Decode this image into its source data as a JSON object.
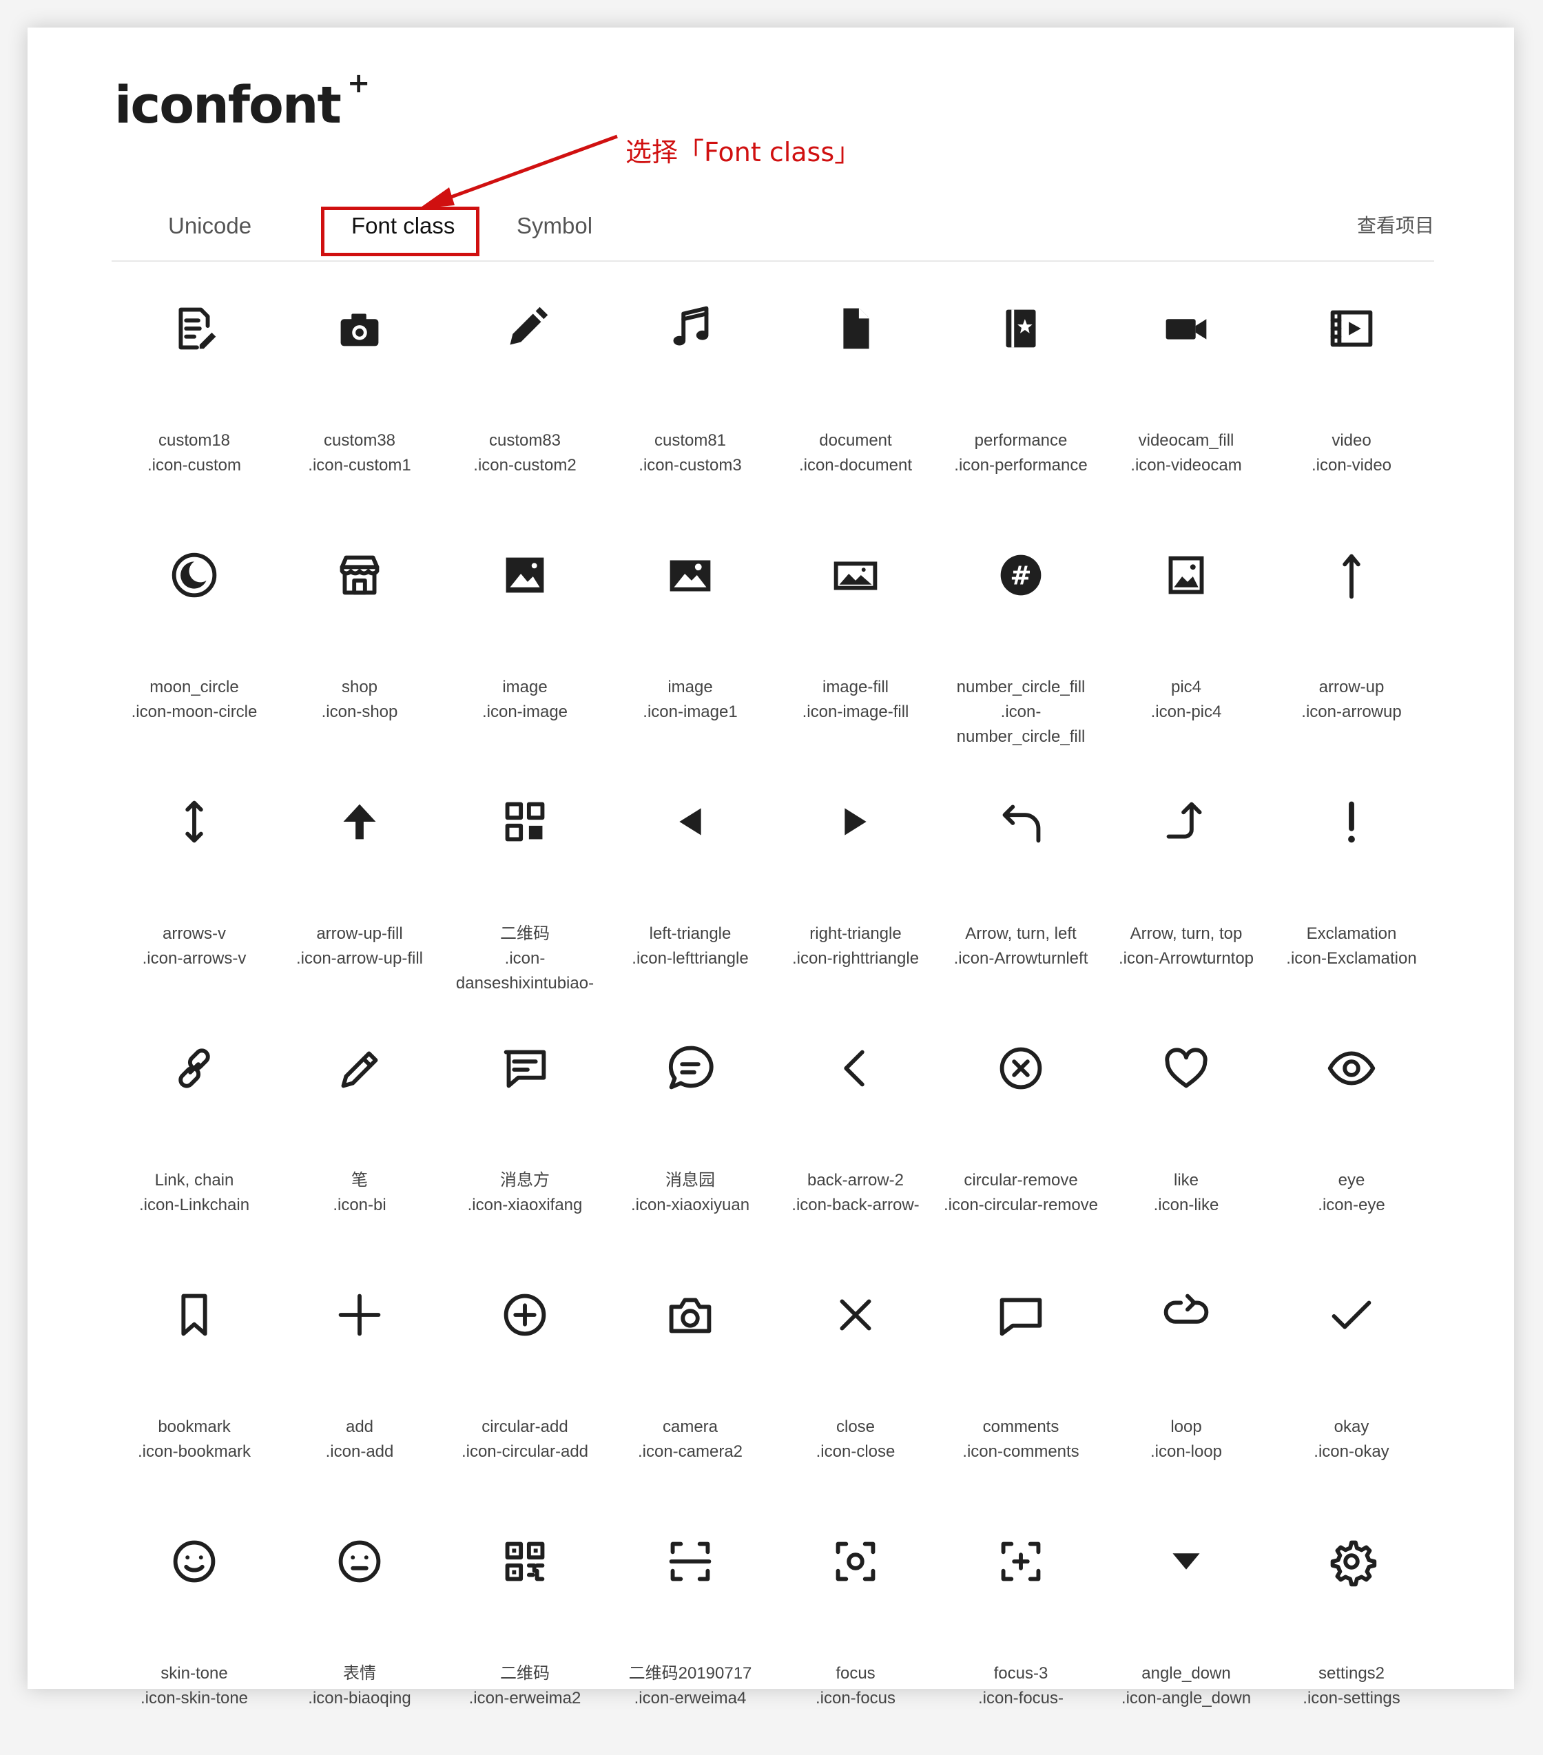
{
  "header": {
    "logo_text": "iconfont",
    "logo_sup": "+",
    "annotation": "选择「Font class」",
    "accent_color": "#d01010"
  },
  "tabs": [
    {
      "label": "Unicode",
      "active": false
    },
    {
      "label": "Font class",
      "active": true
    },
    {
      "label": "Symbol",
      "active": false
    }
  ],
  "view_project": "查看项目",
  "icons": [
    {
      "name": "custom18",
      "class": ".icon-custom",
      "icon": "note-edit-icon"
    },
    {
      "name": "custom38",
      "class": ".icon-custom1",
      "icon": "camera-fill-icon"
    },
    {
      "name": "custom83",
      "class": ".icon-custom2",
      "icon": "pencil-fill-icon"
    },
    {
      "name": "custom81",
      "class": ".icon-custom3",
      "icon": "music-note-icon"
    },
    {
      "name": "document",
      "class": ".icon-document",
      "icon": "document-icon"
    },
    {
      "name": "performance",
      "class": ".icon-performance",
      "icon": "performance-icon"
    },
    {
      "name": "videocam_fill",
      "class": ".icon-videocam",
      "icon": "videocam-icon"
    },
    {
      "name": "video",
      "class": ".icon-video",
      "icon": "video-icon"
    },
    {
      "name": "moon_circle",
      "class": ".icon-moon-circle",
      "icon": "moon-circle-icon"
    },
    {
      "name": "shop",
      "class": ".icon-shop",
      "icon": "shop-icon"
    },
    {
      "name": "image",
      "class": ".icon-image",
      "icon": "image-icon"
    },
    {
      "name": "image",
      "class": ".icon-image1",
      "icon": "image-alt-icon"
    },
    {
      "name": "image-fill",
      "class": ".icon-image-fill",
      "icon": "image-fill-icon"
    },
    {
      "name": "number_circle_fill",
      "class": ".icon-number_circle_fill",
      "icon": "number-circle-icon"
    },
    {
      "name": "pic4",
      "class": ".icon-pic4",
      "icon": "pic-icon"
    },
    {
      "name": "arrow-up",
      "class": ".icon-arrowup",
      "icon": "arrow-up-icon"
    },
    {
      "name": "arrows-v",
      "class": ".icon-arrows-v",
      "icon": "arrows-vertical-icon"
    },
    {
      "name": "arrow-up-fill",
      "class": ".icon-arrow-up-fill",
      "icon": "arrow-up-fill-icon"
    },
    {
      "name": "二维码",
      "class": ".icon-danseshixintubiao-",
      "icon": "qr-grid-icon"
    },
    {
      "name": "left-triangle",
      "class": ".icon-lefttriangle",
      "icon": "left-triangle-icon"
    },
    {
      "name": "right-triangle",
      "class": ".icon-righttriangle",
      "icon": "right-triangle-icon"
    },
    {
      "name": "Arrow, turn, left",
      "class": ".icon-Arrowturnleft",
      "icon": "arrow-turn-left-icon"
    },
    {
      "name": "Arrow, turn, top",
      "class": ".icon-Arrowturntop",
      "icon": "arrow-turn-top-icon"
    },
    {
      "name": "Exclamation",
      "class": ".icon-Exclamation",
      "icon": "exclamation-icon"
    },
    {
      "name": "Link, chain",
      "class": ".icon-Linkchain",
      "icon": "link-chain-icon"
    },
    {
      "name": "笔",
      "class": ".icon-bi",
      "icon": "pen-outline-icon"
    },
    {
      "name": "消息方",
      "class": ".icon-xiaoxifang",
      "icon": "message-square-icon"
    },
    {
      "name": "消息园",
      "class": ".icon-xiaoxiyuan",
      "icon": "message-round-icon"
    },
    {
      "name": "back-arrow-2",
      "class": ".icon-back-arrow-",
      "icon": "back-arrow-icon"
    },
    {
      "name": "circular-remove",
      "class": ".icon-circular-remove",
      "icon": "circle-remove-icon"
    },
    {
      "name": "like",
      "class": ".icon-like",
      "icon": "heart-icon"
    },
    {
      "name": "eye",
      "class": ".icon-eye",
      "icon": "eye-icon"
    },
    {
      "name": "bookmark",
      "class": ".icon-bookmark",
      "icon": "bookmark-icon"
    },
    {
      "name": "add",
      "class": ".icon-add",
      "icon": "plus-icon"
    },
    {
      "name": "circular-add",
      "class": ".icon-circular-add",
      "icon": "circle-add-icon"
    },
    {
      "name": "camera",
      "class": ".icon-camera2",
      "icon": "camera-outline-icon"
    },
    {
      "name": "close",
      "class": ".icon-close",
      "icon": "close-icon"
    },
    {
      "name": "comments",
      "class": ".icon-comments",
      "icon": "comment-icon"
    },
    {
      "name": "loop",
      "class": ".icon-loop",
      "icon": "loop-icon"
    },
    {
      "name": "okay",
      "class": ".icon-okay",
      "icon": "check-icon"
    },
    {
      "name": "skin-tone",
      "class": ".icon-skin-tone",
      "icon": "smile-icon"
    },
    {
      "name": "表情",
      "class": ".icon-biaoqing",
      "icon": "neutral-face-icon"
    },
    {
      "name": "二维码",
      "class": ".icon-erweima2",
      "icon": "qr-code-icon"
    },
    {
      "name": "二维码20190717",
      "class": ".icon-erweima4",
      "icon": "scan-icon"
    },
    {
      "name": "focus",
      "class": ".icon-focus",
      "icon": "focus-icon"
    },
    {
      "name": "focus-3",
      "class": ".icon-focus-",
      "icon": "focus-plus-icon"
    },
    {
      "name": "angle_down",
      "class": ".icon-angle_down",
      "icon": "angle-down-icon"
    },
    {
      "name": "settings2",
      "class": ".icon-settings",
      "icon": "gear-icon"
    }
  ]
}
